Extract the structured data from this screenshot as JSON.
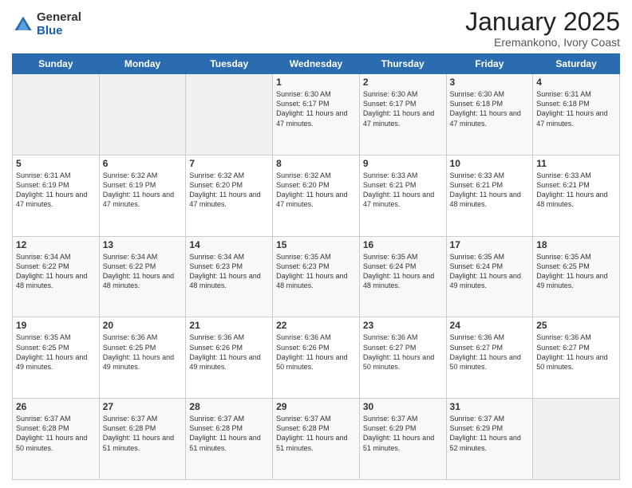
{
  "logo": {
    "general": "General",
    "blue": "Blue"
  },
  "header": {
    "month": "January 2025",
    "location": "Eremankono, Ivory Coast"
  },
  "days_of_week": [
    "Sunday",
    "Monday",
    "Tuesday",
    "Wednesday",
    "Thursday",
    "Friday",
    "Saturday"
  ],
  "weeks": [
    [
      {
        "day": "",
        "sunrise": "",
        "sunset": "",
        "daylight": ""
      },
      {
        "day": "",
        "sunrise": "",
        "sunset": "",
        "daylight": ""
      },
      {
        "day": "",
        "sunrise": "",
        "sunset": "",
        "daylight": ""
      },
      {
        "day": "1",
        "sunrise": "Sunrise: 6:30 AM",
        "sunset": "Sunset: 6:17 PM",
        "daylight": "Daylight: 11 hours and 47 minutes."
      },
      {
        "day": "2",
        "sunrise": "Sunrise: 6:30 AM",
        "sunset": "Sunset: 6:17 PM",
        "daylight": "Daylight: 11 hours and 47 minutes."
      },
      {
        "day": "3",
        "sunrise": "Sunrise: 6:30 AM",
        "sunset": "Sunset: 6:18 PM",
        "daylight": "Daylight: 11 hours and 47 minutes."
      },
      {
        "day": "4",
        "sunrise": "Sunrise: 6:31 AM",
        "sunset": "Sunset: 6:18 PM",
        "daylight": "Daylight: 11 hours and 47 minutes."
      }
    ],
    [
      {
        "day": "5",
        "sunrise": "Sunrise: 6:31 AM",
        "sunset": "Sunset: 6:19 PM",
        "daylight": "Daylight: 11 hours and 47 minutes."
      },
      {
        "day": "6",
        "sunrise": "Sunrise: 6:32 AM",
        "sunset": "Sunset: 6:19 PM",
        "daylight": "Daylight: 11 hours and 47 minutes."
      },
      {
        "day": "7",
        "sunrise": "Sunrise: 6:32 AM",
        "sunset": "Sunset: 6:20 PM",
        "daylight": "Daylight: 11 hours and 47 minutes."
      },
      {
        "day": "8",
        "sunrise": "Sunrise: 6:32 AM",
        "sunset": "Sunset: 6:20 PM",
        "daylight": "Daylight: 11 hours and 47 minutes."
      },
      {
        "day": "9",
        "sunrise": "Sunrise: 6:33 AM",
        "sunset": "Sunset: 6:21 PM",
        "daylight": "Daylight: 11 hours and 47 minutes."
      },
      {
        "day": "10",
        "sunrise": "Sunrise: 6:33 AM",
        "sunset": "Sunset: 6:21 PM",
        "daylight": "Daylight: 11 hours and 48 minutes."
      },
      {
        "day": "11",
        "sunrise": "Sunrise: 6:33 AM",
        "sunset": "Sunset: 6:21 PM",
        "daylight": "Daylight: 11 hours and 48 minutes."
      }
    ],
    [
      {
        "day": "12",
        "sunrise": "Sunrise: 6:34 AM",
        "sunset": "Sunset: 6:22 PM",
        "daylight": "Daylight: 11 hours and 48 minutes."
      },
      {
        "day": "13",
        "sunrise": "Sunrise: 6:34 AM",
        "sunset": "Sunset: 6:22 PM",
        "daylight": "Daylight: 11 hours and 48 minutes."
      },
      {
        "day": "14",
        "sunrise": "Sunrise: 6:34 AM",
        "sunset": "Sunset: 6:23 PM",
        "daylight": "Daylight: 11 hours and 48 minutes."
      },
      {
        "day": "15",
        "sunrise": "Sunrise: 6:35 AM",
        "sunset": "Sunset: 6:23 PM",
        "daylight": "Daylight: 11 hours and 48 minutes."
      },
      {
        "day": "16",
        "sunrise": "Sunrise: 6:35 AM",
        "sunset": "Sunset: 6:24 PM",
        "daylight": "Daylight: 11 hours and 48 minutes."
      },
      {
        "day": "17",
        "sunrise": "Sunrise: 6:35 AM",
        "sunset": "Sunset: 6:24 PM",
        "daylight": "Daylight: 11 hours and 49 minutes."
      },
      {
        "day": "18",
        "sunrise": "Sunrise: 6:35 AM",
        "sunset": "Sunset: 6:25 PM",
        "daylight": "Daylight: 11 hours and 49 minutes."
      }
    ],
    [
      {
        "day": "19",
        "sunrise": "Sunrise: 6:35 AM",
        "sunset": "Sunset: 6:25 PM",
        "daylight": "Daylight: 11 hours and 49 minutes."
      },
      {
        "day": "20",
        "sunrise": "Sunrise: 6:36 AM",
        "sunset": "Sunset: 6:25 PM",
        "daylight": "Daylight: 11 hours and 49 minutes."
      },
      {
        "day": "21",
        "sunrise": "Sunrise: 6:36 AM",
        "sunset": "Sunset: 6:26 PM",
        "daylight": "Daylight: 11 hours and 49 minutes."
      },
      {
        "day": "22",
        "sunrise": "Sunrise: 6:36 AM",
        "sunset": "Sunset: 6:26 PM",
        "daylight": "Daylight: 11 hours and 50 minutes."
      },
      {
        "day": "23",
        "sunrise": "Sunrise: 6:36 AM",
        "sunset": "Sunset: 6:27 PM",
        "daylight": "Daylight: 11 hours and 50 minutes."
      },
      {
        "day": "24",
        "sunrise": "Sunrise: 6:36 AM",
        "sunset": "Sunset: 6:27 PM",
        "daylight": "Daylight: 11 hours and 50 minutes."
      },
      {
        "day": "25",
        "sunrise": "Sunrise: 6:36 AM",
        "sunset": "Sunset: 6:27 PM",
        "daylight": "Daylight: 11 hours and 50 minutes."
      }
    ],
    [
      {
        "day": "26",
        "sunrise": "Sunrise: 6:37 AM",
        "sunset": "Sunset: 6:28 PM",
        "daylight": "Daylight: 11 hours and 50 minutes."
      },
      {
        "day": "27",
        "sunrise": "Sunrise: 6:37 AM",
        "sunset": "Sunset: 6:28 PM",
        "daylight": "Daylight: 11 hours and 51 minutes."
      },
      {
        "day": "28",
        "sunrise": "Sunrise: 6:37 AM",
        "sunset": "Sunset: 6:28 PM",
        "daylight": "Daylight: 11 hours and 51 minutes."
      },
      {
        "day": "29",
        "sunrise": "Sunrise: 6:37 AM",
        "sunset": "Sunset: 6:28 PM",
        "daylight": "Daylight: 11 hours and 51 minutes."
      },
      {
        "day": "30",
        "sunrise": "Sunrise: 6:37 AM",
        "sunset": "Sunset: 6:29 PM",
        "daylight": "Daylight: 11 hours and 51 minutes."
      },
      {
        "day": "31",
        "sunrise": "Sunrise: 6:37 AM",
        "sunset": "Sunset: 6:29 PM",
        "daylight": "Daylight: 11 hours and 52 minutes."
      },
      {
        "day": "",
        "sunrise": "",
        "sunset": "",
        "daylight": ""
      }
    ]
  ]
}
